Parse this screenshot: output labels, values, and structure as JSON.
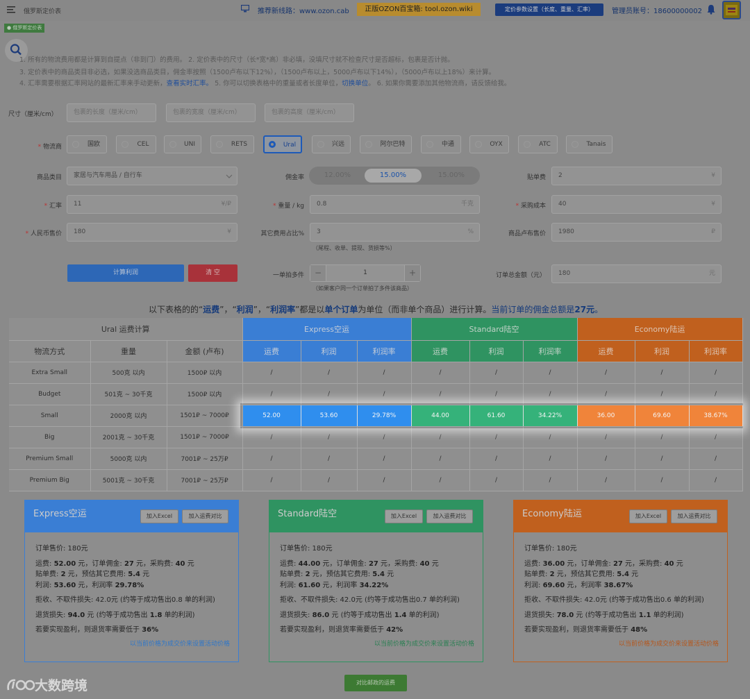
{
  "topbar": {
    "breadcrumb": "俄罗斯定价表",
    "tab_label": "● 俄罗斯定价表",
    "recommend": "推荐新线路：www.ozon.cab",
    "tool_banner": "正版OZON百宝箱: tool.ozon.wiki",
    "settings_button": "定价参数设置（长度、重量、汇率）",
    "account": "管理员账号：18600000002"
  },
  "notes": {
    "line1": "1. 所有的物流费用都是计算到自提点（非到门）的费用。  2. 定价表中的尺寸（长*宽*高）非必填，没填尺寸就不检查尺寸是否超标，包裹是否计抛。",
    "line2": "3. 定价表中的商品类目非必选，如果没选商品类目，佣金率按照（1500卢布以下12%），（1500卢布以上，5000卢布以下14%），（5000卢布以上18%）来计算。",
    "line3a": "4. 汇率需要根据汇率网站的最新汇率来手动更新，",
    "line3_link1": "查看实时汇率。",
    "line3b": "  5. 你可以切换表格中的重量或者长度单位，",
    "line3_link2": "切换单位",
    "line3c": "。  6. 如果你需要添加其他物流商，请反馈给我。"
  },
  "form": {
    "size_label": "尺寸（厘米/cm）",
    "length_placeholder": "包裹的长度（厘米/cm）",
    "width_placeholder": "包裹的宽度（厘米/cm）",
    "height_placeholder": "包裹的高度（厘米/cm）",
    "carrier_label": "物流商",
    "carriers": [
      "国欧",
      "CEL",
      "UNI",
      "RETS",
      "Ural",
      "兴远",
      "阿尔巴特",
      "中通",
      "OYX",
      "ATC",
      "Tanais"
    ],
    "selected_carrier": "Ural",
    "category_label": "商品类目",
    "category_value": "家居与汽车用品 / 自行车",
    "commission_label": "佣金率",
    "commission_options": [
      "12.00%",
      "15.00%",
      "15.00%"
    ],
    "listing_fee_label": "贴单费",
    "listing_fee_value": "2",
    "yuan_unit": "¥",
    "rate_label": "汇率",
    "rate_value": "11",
    "rate_unit": "¥/₽",
    "weight_label": "重量 / kg",
    "weight_value": "0.8",
    "weight_unit": "千克",
    "purchase_label": "采购成本",
    "purchase_value": "40",
    "rmb_price_label": "人民币售价",
    "rmb_price_value": "180",
    "other_fee_label": "其它费用占比%",
    "other_fee_value": "3",
    "percent_unit": "%",
    "other_fee_hint": "（尾程、收单、提现、货损等%）",
    "rub_price_label": "商品卢布售价",
    "rub_price_value": "1980",
    "rub_unit": "₽",
    "calc_button": "计算利润",
    "clear_button": "清 空",
    "multi_label": "一单拍多件",
    "multi_value": "1",
    "minus": "−",
    "plus": "+",
    "multi_hint": "（如果客户同一个订单拍了多件该商品）",
    "order_total_label": "订单总金额（元）",
    "order_total_value": "180",
    "order_total_unit": "元"
  },
  "summary": {
    "p1": "以下表格的的“",
    "k1": "运费",
    "p2": "”，“",
    "k2": "利润",
    "p3": "”，“",
    "k3": "利润率",
    "p4": "”都是以",
    "k4": "单个订单",
    "p5": "为单位（而非单个商品）进行计算。",
    "p6": "当前订单的佣金总额是",
    "k6": "27元",
    "p7": "。"
  },
  "table": {
    "carrier_title": "Ural 运费计算",
    "col_method": "物流方式",
    "col_weight": "重量",
    "col_amount": "金额 (卢布)",
    "groups": [
      "Express空运",
      "Standard陆空",
      "Economy陆运"
    ],
    "sub_cols": [
      "运费",
      "利润",
      "利润率"
    ],
    "rows": [
      {
        "method": "Extra Small",
        "weight": "500克 以内",
        "amount": "1500₽ 以内",
        "values": [
          "/",
          "/",
          "/",
          "/",
          "/",
          "/",
          "/",
          "/",
          "/"
        ]
      },
      {
        "method": "Budget",
        "weight": "501克 ~ 30千克",
        "amount": "1500₽ 以内",
        "values": [
          "/",
          "/",
          "/",
          "/",
          "/",
          "/",
          "/",
          "/",
          "/"
        ]
      },
      {
        "method": "Small",
        "weight": "2000克 以内",
        "amount": "1501₽ ~ 7000₽",
        "values": [
          "52.00",
          "53.60",
          "29.78%",
          "44.00",
          "61.60",
          "34.22%",
          "36.00",
          "69.60",
          "38.67%"
        ]
      },
      {
        "method": "Big",
        "weight": "2001克 ~ 30千克",
        "amount": "1501₽ ~ 7000₽",
        "values": [
          "/",
          "/",
          "/",
          "/",
          "/",
          "/",
          "/",
          "/",
          "/"
        ]
      },
      {
        "method": "Premium Small",
        "weight": "5000克 以内",
        "amount": "7001₽ ~ 25万₽",
        "values": [
          "/",
          "/",
          "/",
          "/",
          "/",
          "/",
          "/",
          "/",
          "/"
        ]
      },
      {
        "method": "Premium Big",
        "weight": "5001克 ~ 30千克",
        "amount": "7001₽ ~ 25万₽",
        "values": [
          "/",
          "/",
          "/",
          "/",
          "/",
          "/",
          "/",
          "/",
          "/"
        ]
      }
    ]
  },
  "cards": [
    {
      "title": "Express空运",
      "excel": "加入Excel",
      "compare": "加入运费对比",
      "sale_price": "订单售价: 180元",
      "l2a": "运费: ",
      "freight": "52.00",
      "l2b": " 元，订单佣金: ",
      "commission": "27",
      "l2c": " 元，采购费: ",
      "purchase": "40",
      "l2d": " 元",
      "l3a": "贴单费: ",
      "listing": "2",
      "l3b": " 元，预估其它费用: ",
      "other": "5.4",
      "l3c": " 元",
      "l4a": "利润: ",
      "profit": "53.60",
      "l4b": " 元，利润率 ",
      "margin": "29.78%",
      "reject": "拒收、不取件损失: 42.0元  (约等于成功售出0.8 单的利润)",
      "r1a": "退货损失: ",
      "return_loss": "94.0",
      "r1b": " 元  (约等于成功售出 ",
      "return_units": "1.8",
      "r1c": " 单的利润)",
      "t1a": "若要实现盈利，则退货率需要低于 ",
      "threshold": "36%",
      "link": "以当前价格为成交价来设置活动价格",
      "color": "#2f76c8"
    },
    {
      "title": "Standard陆空",
      "excel": "加入Excel",
      "compare": "加入运费对比",
      "sale_price": "订单售价: 180元",
      "l2a": "运费: ",
      "freight": "44.00",
      "l2b": " 元，订单佣金: ",
      "commission": "27",
      "l2c": " 元，采购费: ",
      "purchase": "40",
      "l2d": " 元",
      "l3a": "贴单费: ",
      "listing": "2",
      "l3b": " 元，预估其它费用: ",
      "other": "5.4",
      "l3c": " 元",
      "l4a": "利润: ",
      "profit": "61.60",
      "l4b": " 元，利润率 ",
      "margin": "34.22%",
      "reject": "拒收、不取件损失: 42.0元  (约等于成功售出0.7 单的利润)",
      "r1a": "退货损失: ",
      "return_loss": "86.0",
      "r1b": " 元  (约等于成功售出 ",
      "return_units": "1.4",
      "r1c": " 单的利润)",
      "t1a": "若要实现盈利，则退货率需要低于 ",
      "threshold": "42%",
      "link": "以当前价格为成交价来设置活动价格",
      "color": "#2a7f52"
    },
    {
      "title": "Economy陆运",
      "excel": "加入Excel",
      "compare": "加入运费对比",
      "sale_price": "订单售价: 180元",
      "l2a": "运费: ",
      "freight": "36.00",
      "l2b": " 元，订单佣金: ",
      "commission": "27",
      "l2c": " 元，采购费: ",
      "purchase": "40",
      "l2d": " 元",
      "l3a": "贴单费: ",
      "listing": "2",
      "l3b": " 元，预估其它费用: ",
      "other": "5.4",
      "l3c": " 元",
      "l4a": "利润: ",
      "profit": "69.60",
      "l4b": " 元，利润率 ",
      "margin": "38.67%",
      "reject": "拒收、不取件损失: 42.0元  (约等于成功售出0.6 单的利润)",
      "r1a": "退货损失: ",
      "return_loss": "78.0",
      "r1b": " 元  (约等于成功售出 ",
      "return_units": "1.1",
      "r1c": " 单的利润)",
      "t1a": "若要实现盈利，则退货率需要低于 ",
      "threshold": "48%",
      "link": "以当前价格为成交价来设置活动价格",
      "color": "#b5561c"
    }
  ],
  "compare_button": "对比邮政的运费",
  "watermark": "大数跨境",
  "colors": {
    "express": "#3a7ed4",
    "standard": "#2f9361",
    "economy": "#c0601e",
    "express_hl": "#2f8eee",
    "standard_hl": "#35b27a",
    "economy_hl": "#f0843a"
  }
}
